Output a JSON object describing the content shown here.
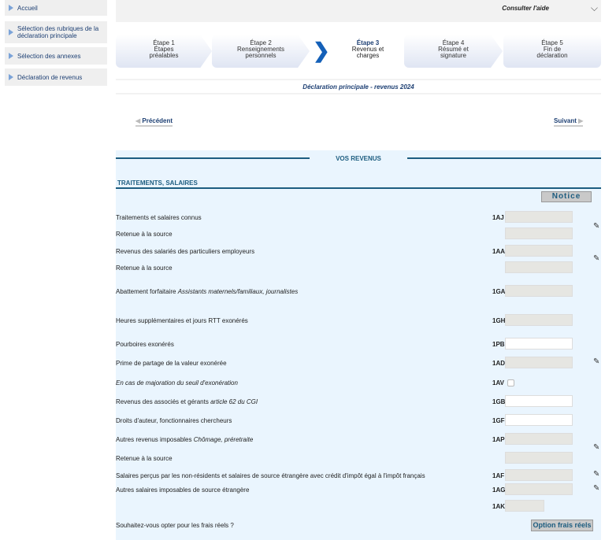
{
  "sidebar": {
    "items": [
      {
        "label": "Accueil"
      },
      {
        "label": "Sélection des rubriques de la déclaration principale"
      },
      {
        "label": "Sélection des annexes"
      },
      {
        "label": "Déclaration de revenus"
      }
    ]
  },
  "header": {
    "help": "Consulter l'aide"
  },
  "steps": [
    {
      "num": "Étape 1",
      "label": "Étapes préalables"
    },
    {
      "num": "Étape 2",
      "label": "Renseignements personnels"
    },
    {
      "num": "Étape 3",
      "label": "Revenus et charges"
    },
    {
      "num": "Étape 4",
      "label": "Résumé et signature"
    },
    {
      "num": "Étape 5",
      "label": "Fin de déclaration"
    }
  ],
  "page_title": "Déclaration principale - revenus 2024",
  "nav": {
    "prev": "Précédent",
    "next": "Suivant"
  },
  "section": {
    "title": "VOS REVENUS",
    "subtitle": "TRAITEMENTS, SALAIRES",
    "notice": "Notice"
  },
  "rows": [
    {
      "label": "Traitements et salaires connus",
      "code": "1AJ"
    },
    {
      "label": "Retenue à la source",
      "code": ""
    },
    {
      "label": "Revenus des salariés des particuliers employeurs",
      "code": "1AA"
    },
    {
      "label": "Retenue à la source",
      "code": ""
    },
    {
      "label": "Abattement forfaitaire ",
      "label_em": "Assistants maternels/familiaux, journalistes",
      "code": "1GA"
    },
    {
      "label": "Heures supplémentaires et jours RTT exonérés",
      "code": "1GH"
    },
    {
      "label": "Pourboires exonérés",
      "code": "1PB"
    },
    {
      "label": "Prime de partage de la valeur exonérée",
      "code": "1AD"
    },
    {
      "label": "",
      "label_em": "En cas de majoration du seuil d'exonération",
      "code": "1AV"
    },
    {
      "label": "Revenus des associés et gérants ",
      "label_em": "article 62 du CGI",
      "code": "1GB"
    },
    {
      "label": "Droits d'auteur, fonctionnaires chercheurs",
      "code": "1GF"
    },
    {
      "label": "Autres revenus imposables ",
      "label_em": "Chômage, préretraite",
      "code": "1AP"
    },
    {
      "label": "Retenue à la source",
      "code": ""
    },
    {
      "label": "Salaires perçus par les non-résidents et salaires de source étrangère avec crédit d'impôt égal à l'impôt français",
      "code": "1AF"
    },
    {
      "label": "Autres salaires imposables de source étrangère",
      "code": "1AG"
    },
    {
      "label": "",
      "code": "1AK"
    }
  ],
  "frais": {
    "question": "Souhaitez-vous opter pour les frais réels ?",
    "button": "Option frais réels"
  }
}
